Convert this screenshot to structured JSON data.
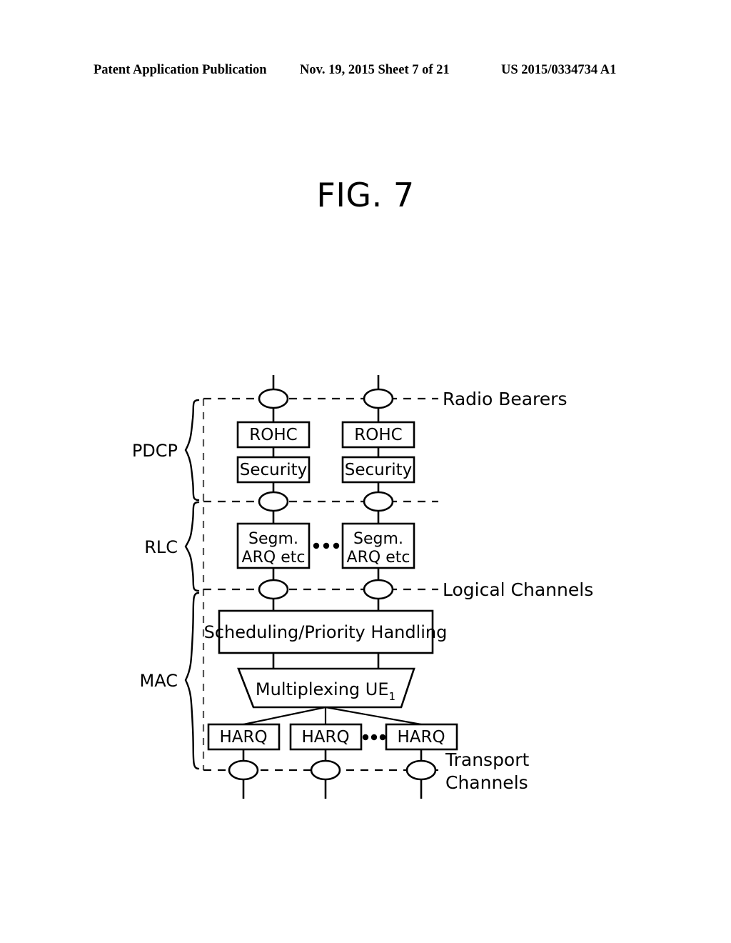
{
  "header": {
    "publication": "Patent Application Publication",
    "date_sheet": "Nov. 19, 2015   Sheet 7 of 21",
    "patent_number": "US 2015/0334734 A1"
  },
  "figure": {
    "title": "FIG. 7"
  },
  "diagram": {
    "layers": [
      {
        "id": "pdcp",
        "label": "PDCP"
      },
      {
        "id": "rlc",
        "label": "RLC"
      },
      {
        "id": "mac",
        "label": "MAC"
      }
    ],
    "interfaces": [
      {
        "id": "radio-bearers",
        "label": "Radio Bearers"
      },
      {
        "id": "logical-channels",
        "label": "Logical Channels"
      },
      {
        "id": "transport-channels",
        "label_line1": "Transport",
        "label_line2": "Channels"
      }
    ],
    "pdcp_blocks": [
      {
        "id": "rohc-left",
        "label": "ROHC"
      },
      {
        "id": "rohc-right",
        "label": "ROHC"
      },
      {
        "id": "security-left",
        "label": "Security"
      },
      {
        "id": "security-right",
        "label": "Security"
      }
    ],
    "rlc_blocks": [
      {
        "id": "rlc-left",
        "line1": "Segm.",
        "line2": "ARQ etc"
      },
      {
        "id": "rlc-right",
        "line1": "Segm.",
        "line2": "ARQ etc"
      }
    ],
    "mac_blocks": {
      "scheduling": "Scheduling/Priority Handling",
      "multiplexing": "Multiplexing UE",
      "multiplexing_subscript": "1",
      "harq": [
        {
          "id": "harq-1",
          "label": "HARQ"
        },
        {
          "id": "harq-2",
          "label": "HARQ"
        },
        {
          "id": "harq-3",
          "label": "HARQ"
        }
      ]
    },
    "ellipsis": "• • •",
    "colors": {
      "stroke": "#000000",
      "background": "#ffffff"
    }
  }
}
